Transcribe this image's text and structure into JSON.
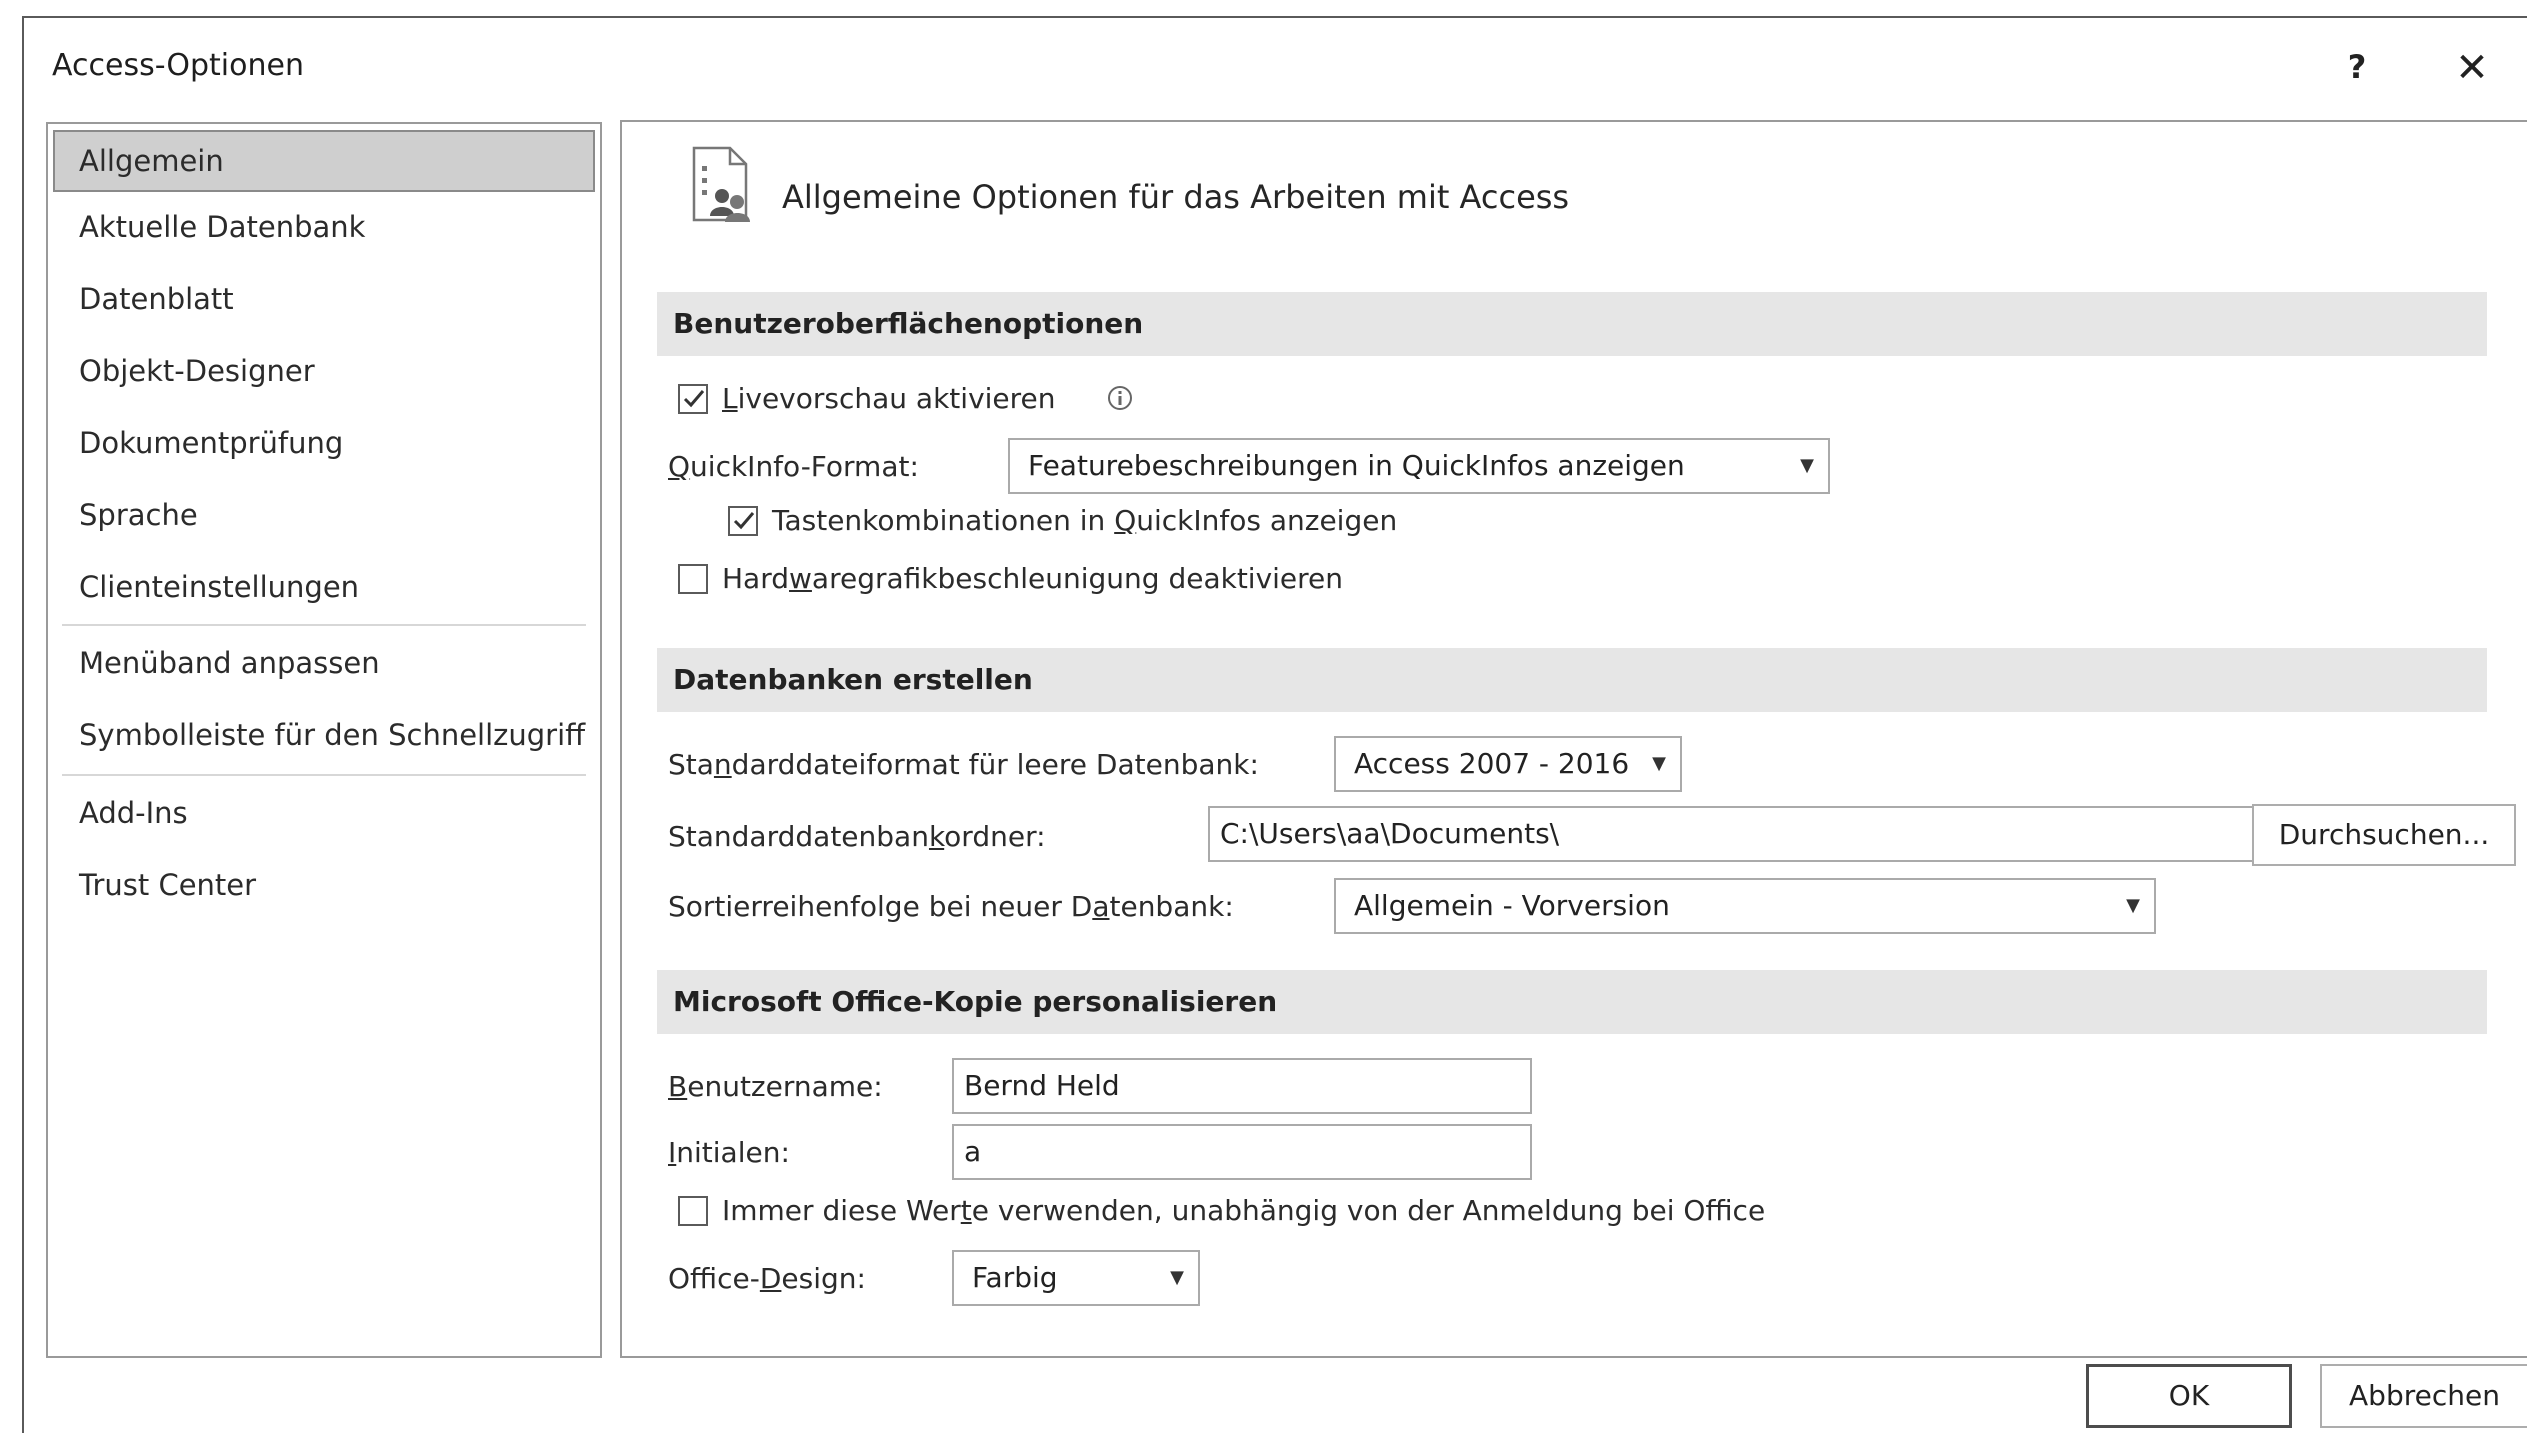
{
  "window": {
    "title": "Access-Optionen",
    "help_label": "?",
    "close_label": "✕"
  },
  "nav": {
    "items": [
      {
        "label": "Allgemein",
        "selected": true
      },
      {
        "label": "Aktuelle Datenbank"
      },
      {
        "label": "Datenblatt"
      },
      {
        "label": "Objekt-Designer"
      },
      {
        "label": "Dokumentprüfung"
      },
      {
        "label": "Sprache"
      },
      {
        "label": "Clienteinstellungen"
      },
      {
        "label": "Menüband anpassen"
      },
      {
        "label": "Symbolleiste für den Schnellzugriff"
      },
      {
        "label": "Add-Ins"
      },
      {
        "label": "Trust Center"
      }
    ]
  },
  "header": {
    "title": "Allgemeine Optionen für das Arbeiten mit Access",
    "icon": "general-options-icon"
  },
  "ui_options": {
    "section_title": "Benutzeroberflächenoptionen",
    "live_preview": {
      "label_prefix": "",
      "label_key": "L",
      "label_rest": "ivevorschau aktivieren",
      "checked": true
    },
    "tooltip_format_label_key": "Q",
    "tooltip_format_label_rest": "uickInfo-Format:",
    "tooltip_format_value": "Featurebeschreibungen in QuickInfos anzeigen",
    "shortcut_keys": {
      "label_prefix": "Tastenkombinationen in ",
      "label_key": "Q",
      "label_rest": "uickInfos anzeigen",
      "checked": true
    },
    "hw_accel": {
      "label_prefix": "Hard",
      "label_key": "w",
      "label_rest": "aregrafikbeschleunigung deaktivieren",
      "checked": false
    }
  },
  "create_db": {
    "section_title": "Datenbanken erstellen",
    "file_format_label_prefix": "Sta",
    "file_format_label_key": "n",
    "file_format_label_rest": "darddateiformat für leere Datenbank:",
    "file_format_value": "Access 2007 - 2016",
    "folder_label_prefix": "Standarddatenban",
    "folder_label_key": "k",
    "folder_label_rest": "ordner:",
    "folder_value": "C:\\Users\\aa\\Documents\\",
    "browse_label": "Durchsuchen...",
    "sort_label_prefix": "Sortierreihenfolge bei neuer D",
    "sort_label_key": "a",
    "sort_label_rest": "tenbank:",
    "sort_value": "Allgemein - Vorversion"
  },
  "personalize": {
    "section_title": "Microsoft Office-Kopie personalisieren",
    "username_label_key": "B",
    "username_label_rest": "enutzername:",
    "username_value": "Bernd Held",
    "initials_label_key": "I",
    "initials_label_rest": "nitialen:",
    "initials_value": "a",
    "always_use": {
      "label_prefix": "Immer diese Wer",
      "label_key": "t",
      "label_rest": "e verwenden, unabhängig von der Anmeldung bei Office",
      "checked": false
    },
    "design_label_prefix": "Office-",
    "design_label_key": "D",
    "design_label_rest": "esign:",
    "design_value": "Farbig"
  },
  "footer": {
    "ok_label": "OK",
    "cancel_label": "Abbrechen"
  }
}
